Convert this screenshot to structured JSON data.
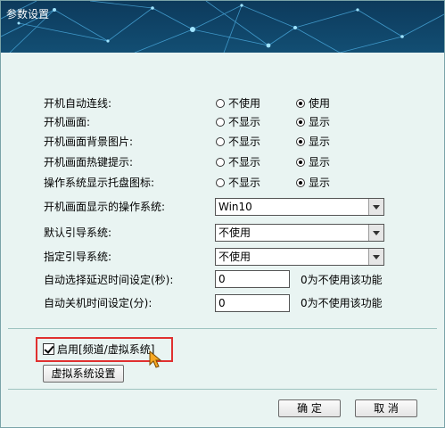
{
  "window": {
    "title": "参数设置"
  },
  "options": [
    {
      "label": "开机自动连线:",
      "opt1": "不使用",
      "opt2": "使用",
      "selected": 2
    },
    {
      "label": "开机画面:",
      "opt1": "不显示",
      "opt2": "显示",
      "selected": 2
    },
    {
      "label": "开机画面背景图片:",
      "opt1": "不显示",
      "opt2": "显示",
      "selected": 2
    },
    {
      "label": "开机画面热键提示:",
      "opt1": "不显示",
      "opt2": "显示",
      "selected": 2
    },
    {
      "label": "操作系统显示托盘图标:",
      "opt1": "不显示",
      "opt2": "显示",
      "selected": 2
    }
  ],
  "selects": [
    {
      "label": "开机画面显示的操作系统:",
      "value": "Win10"
    },
    {
      "label": "默认引导系统:",
      "value": "不使用"
    },
    {
      "label": "指定引导系统:",
      "value": "不使用"
    }
  ],
  "timers": [
    {
      "label": "自动选择延迟时间设定(秒):",
      "value": "0",
      "hint": "0为不使用该功能"
    },
    {
      "label": "自动关机时间设定(分):",
      "value": "0",
      "hint": "0为不使用该功能"
    }
  ],
  "virtual": {
    "checkbox_label": "启用[频道/虚拟系统]",
    "checked": true,
    "settings_button": "虚拟系统设置"
  },
  "footer": {
    "ok": "确 定",
    "cancel": "取 消"
  }
}
